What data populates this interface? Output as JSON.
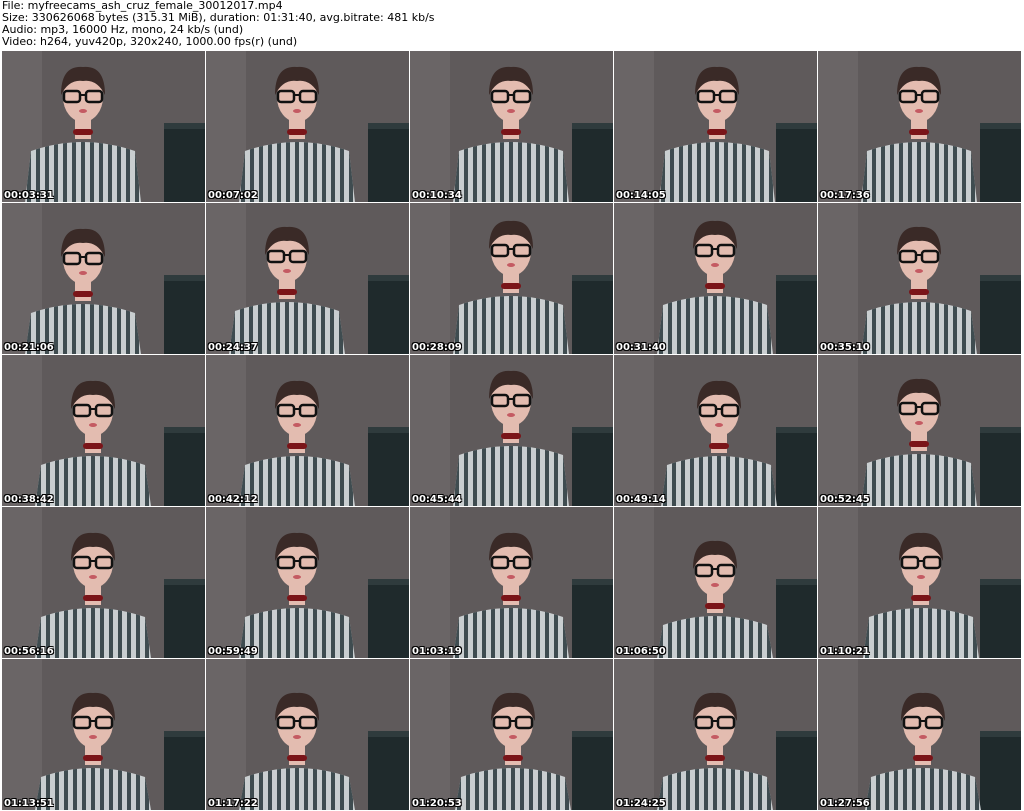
{
  "header": {
    "file_line": "File: myfreecams_ash_cruz_female_30012017.mp4",
    "size_line": "Size: 330626068 bytes (315.31 MiB), duration: 01:31:40, avg.bitrate: 481 kb/s",
    "audio_line": "Audio: mp3, 16000 Hz, mono, 24 kb/s (und)",
    "video_line": "Video: h264, yuv420p, 320x240, 1000.00 fps(r) (und)"
  },
  "colors": {
    "wall": "#5f5a5b",
    "table": "#1f2a2c",
    "dress_light": "#c9ced0",
    "dress_dark": "#3f4c50",
    "skin": "#e3bcb0",
    "hair": "#3a2a27",
    "choker": "#7a1418",
    "glasses": "#111111",
    "timestamp": "#ffffff"
  },
  "thumbnails": [
    {
      "timestamp": "00:03:31"
    },
    {
      "timestamp": "00:07:02"
    },
    {
      "timestamp": "00:10:34"
    },
    {
      "timestamp": "00:14:05"
    },
    {
      "timestamp": "00:17:36"
    },
    {
      "timestamp": "00:21:06"
    },
    {
      "timestamp": "00:24:37"
    },
    {
      "timestamp": "00:28:09"
    },
    {
      "timestamp": "00:31:40"
    },
    {
      "timestamp": "00:35:10"
    },
    {
      "timestamp": "00:38:42"
    },
    {
      "timestamp": "00:42:12"
    },
    {
      "timestamp": "00:45:44"
    },
    {
      "timestamp": "00:49:14"
    },
    {
      "timestamp": "00:52:45"
    },
    {
      "timestamp": "00:56:16"
    },
    {
      "timestamp": "00:59:49"
    },
    {
      "timestamp": "01:03:19"
    },
    {
      "timestamp": "01:06:50"
    },
    {
      "timestamp": "01:10:21"
    },
    {
      "timestamp": "01:13:51"
    },
    {
      "timestamp": "01:17:22"
    },
    {
      "timestamp": "01:20:53"
    },
    {
      "timestamp": "01:24:25"
    },
    {
      "timestamp": "01:27:56"
    }
  ]
}
